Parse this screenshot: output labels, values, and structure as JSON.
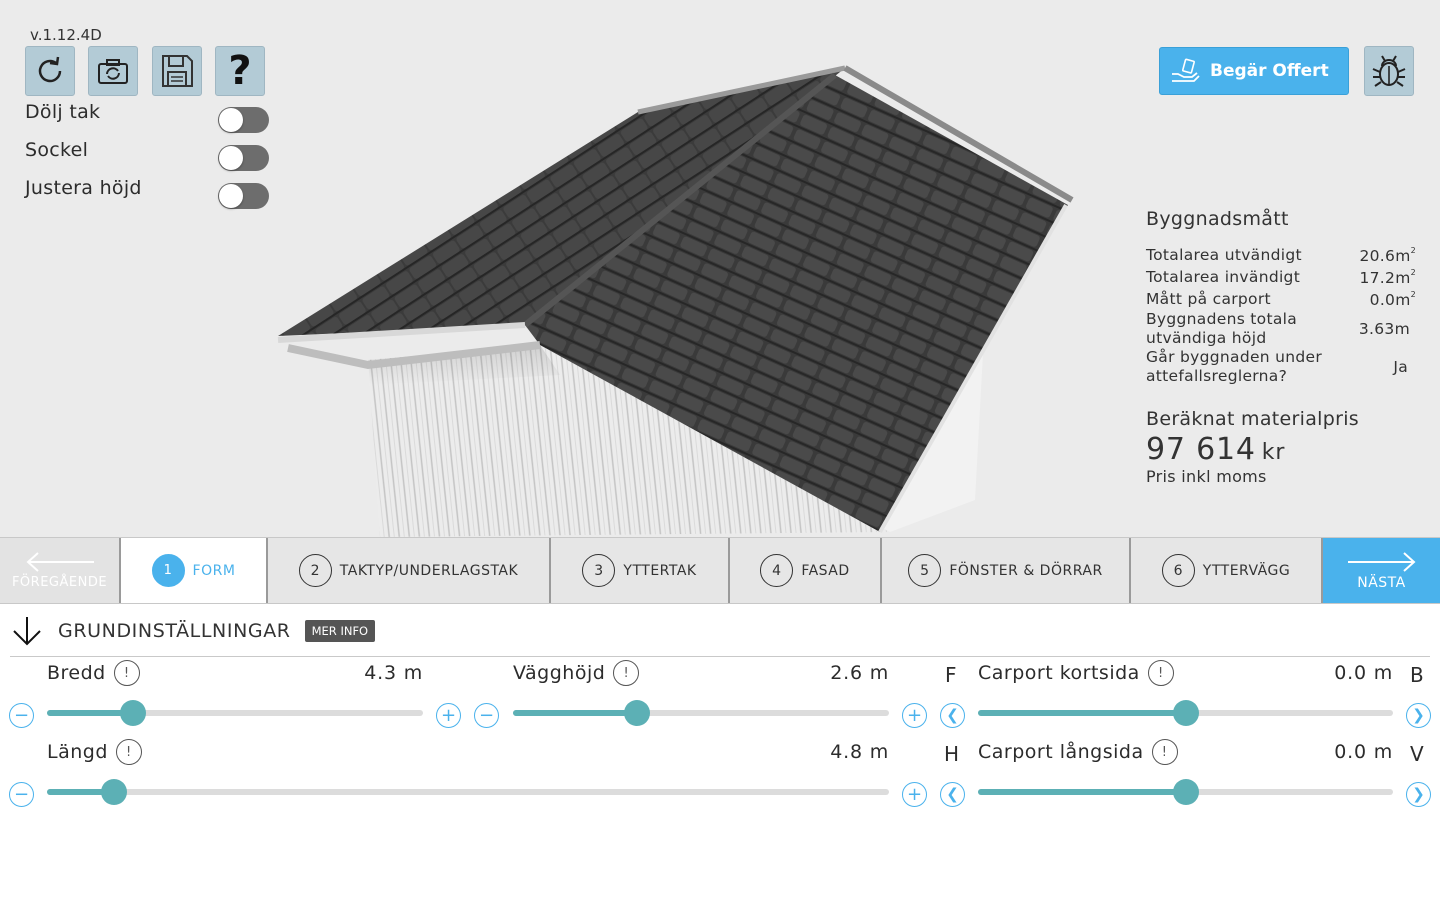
{
  "app": {
    "version": "v.1.12.4D"
  },
  "toolbar": {
    "buttons": [
      {
        "name": "reset",
        "icon": "refresh-icon"
      },
      {
        "name": "snapshot",
        "icon": "camera-rotate-icon"
      },
      {
        "name": "save",
        "icon": "floppy-disk-icon"
      },
      {
        "name": "help",
        "icon": "question-mark-icon"
      }
    ]
  },
  "toggles": [
    {
      "label": "Dölj tak",
      "on": false
    },
    {
      "label": "Sockel",
      "on": false
    },
    {
      "label": "Justera höjd",
      "on": false
    }
  ],
  "quote_button": {
    "label": "Begär Offert",
    "icon": "hand-card-icon"
  },
  "debug_button": {
    "icon": "bug-icon"
  },
  "dimensions": {
    "title": "Byggnadsmått",
    "rows": [
      {
        "label": "Totalarea utvändigt",
        "value": "20.6m",
        "sup": "2"
      },
      {
        "label": "Totalarea invändigt",
        "value": "17.2m",
        "sup": "2"
      },
      {
        "label": "Mått på carport",
        "value": "0.0m",
        "sup": "2"
      },
      {
        "label": "Byggnadens totala utvändiga höjd",
        "value": "3.63m",
        "sup": ""
      },
      {
        "label": "Går byggnaden under attefallsreglerna?",
        "value": "Ja",
        "sup": ""
      }
    ]
  },
  "price": {
    "title": "Beräknat materialpris",
    "value": "97 614",
    "currency": "kr",
    "note": "Pris inkl moms"
  },
  "steps": {
    "prev_label": "FÖREGÅENDE",
    "next_label": "NÄSTA",
    "items": [
      {
        "num": "1",
        "label": "FORM",
        "active": true
      },
      {
        "num": "2",
        "label": "TAKTYP/UNDERLAGSTAK",
        "active": false
      },
      {
        "num": "3",
        "label": "YTTERTAK",
        "active": false
      },
      {
        "num": "4",
        "label": "FASAD",
        "active": false
      },
      {
        "num": "5",
        "label": "FÖNSTER & DÖRRAR",
        "active": false
      },
      {
        "num": "6",
        "label": "YTTERVÄGG",
        "active": false
      }
    ]
  },
  "settings": {
    "title": "GRUNDINSTÄLLNINGAR",
    "more_info": "MER INFO",
    "sliders": {
      "bredd": {
        "label": "Bredd",
        "value": "4.3 m",
        "fraction": 0.23
      },
      "vagghojd": {
        "label": "Vägghöjd",
        "value": "2.6 m",
        "fraction": 0.33
      },
      "langd": {
        "label": "Längd",
        "value": "4.8 m",
        "fraction": 0.08
      },
      "carport_kortsida": {
        "label": "Carport kortsida",
        "value": "0.0 m",
        "fraction": 0.5,
        "left_letter": "F",
        "right_letter": "B"
      },
      "carport_langsida": {
        "label": "Carport långsida",
        "value": "0.0 m",
        "fraction": 0.5,
        "left_letter": "H",
        "right_letter": "V"
      }
    }
  },
  "colors": {
    "accent": "#4ab2ec",
    "slider": "#5cb0b5",
    "toolbar_button": "#b3cbd6",
    "viewport_bg": "#ebebeb",
    "roof": "#3a3a3a"
  }
}
